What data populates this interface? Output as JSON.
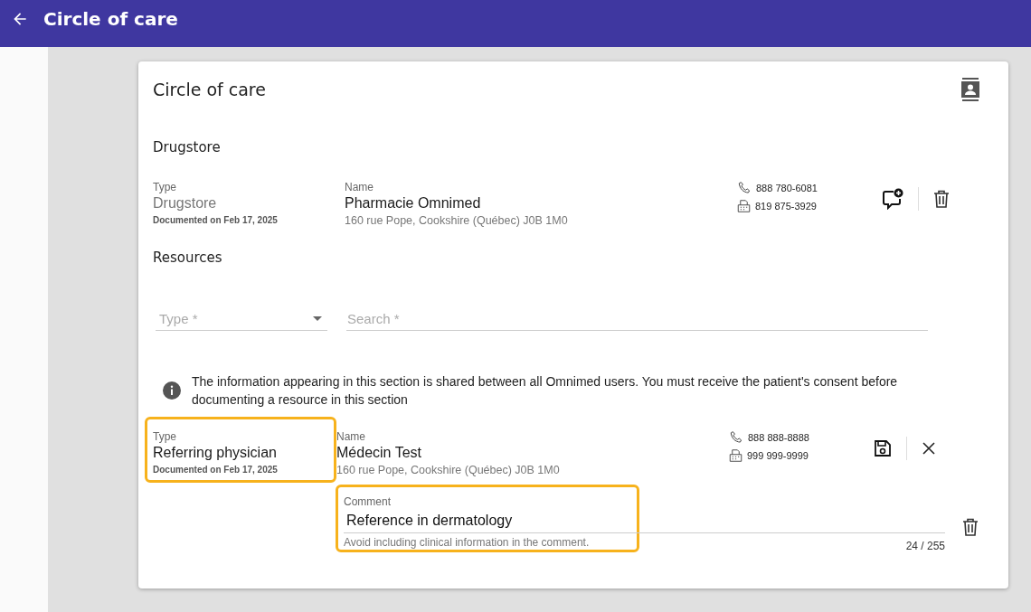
{
  "app_bar": {
    "title": "Circle of care"
  },
  "card": {
    "title": "Circle of care",
    "drugstore": {
      "heading": "Drugstore",
      "entry": {
        "kind": "saved",
        "type_label": "Type",
        "type": "Drugstore",
        "documented": "Documented on Feb 17, 2025",
        "name_label": "Name",
        "name": "Pharmacie Omnimed",
        "address": "160 rue Pope, Cookshire (Québec) J0B 1M0",
        "phone": "888 780-6081",
        "fax": "819 875-3929",
        "highlighted": false
      }
    },
    "resources": {
      "heading": "Resources",
      "type_field": {
        "placeholder": "Type *"
      },
      "search_field": {
        "placeholder": "Search *"
      },
      "info": "The information appearing in this section is shared between all Omnimed users. You must receive the patient's consent before documenting a resource in this section",
      "entry": {
        "kind": "editing",
        "type_label": "Type",
        "type": "Referring physician",
        "documented": "Documented on Feb 17, 2025",
        "name_label": "Name",
        "name": "Médecin Test",
        "address": "160 rue Pope, Cookshire (Québec) J0B 1M0",
        "phone": "888 888-8888",
        "fax": "999 999-9999",
        "highlighted": true,
        "comment": {
          "label": "Comment",
          "value": "Reference in dermatology",
          "hint": "Avoid including clinical information in the comment.",
          "counter": "24 / 255",
          "highlighted": true
        }
      }
    }
  }
}
